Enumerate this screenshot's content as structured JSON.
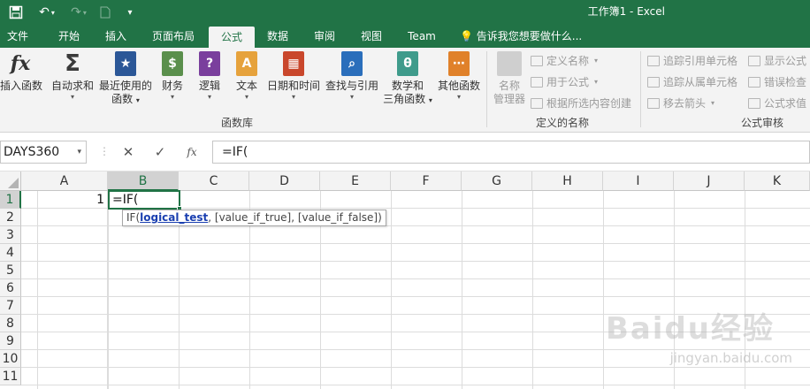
{
  "window": {
    "title": "工作簿1 - Excel"
  },
  "quick_access": {
    "save_icon": "save-icon",
    "undo_icon": "undo-icon",
    "redo_icon": "redo-icon",
    "new_icon": "new-file-icon",
    "customize_icon": "customize-icon"
  },
  "tabs": [
    {
      "label": "文件"
    },
    {
      "label": "开始"
    },
    {
      "label": "插入"
    },
    {
      "label": "页面布局"
    },
    {
      "label": "公式"
    },
    {
      "label": "数据"
    },
    {
      "label": "审阅"
    },
    {
      "label": "视图"
    },
    {
      "label": "Team"
    }
  ],
  "tell_me": "告诉我您想要做什么...",
  "ribbon": {
    "function_library": {
      "label": "函数库",
      "buttons": [
        {
          "label": "插入函数",
          "glyph": "fx",
          "color": "#3a3a3a"
        },
        {
          "label": "自动求和",
          "glyph": "Σ",
          "color": "#4a4a4a"
        },
        {
          "label": "最近使用的",
          "label2": "函数",
          "glyph": "★",
          "color": "#2b5797"
        },
        {
          "label": "财务",
          "glyph": "$",
          "color": "#5a8f4c"
        },
        {
          "label": "逻辑",
          "glyph": "?",
          "color": "#7a3f9d"
        },
        {
          "label": "文本",
          "glyph": "A",
          "color": "#e6a23c"
        },
        {
          "label": "日期和时间",
          "glyph": "▦",
          "color": "#c9472c"
        },
        {
          "label": "查找与引用",
          "glyph": "⌕",
          "color": "#2a6ebb"
        },
        {
          "label": "数学和",
          "label2": "三角函数",
          "glyph": "θ",
          "color": "#3f9b8b"
        },
        {
          "label": "其他函数",
          "glyph": "⋯",
          "color": "#e0812a"
        }
      ]
    },
    "defined_names": {
      "label": "定义的名称",
      "manager_label": "名称",
      "manager_label2": "管理器",
      "items": [
        "定义名称",
        "用于公式",
        "根据所选内容创建"
      ]
    },
    "formula_auditing": {
      "label": "公式审核",
      "items": [
        "追踪引用单元格",
        "追踪从属单元格",
        "移去箭头",
        "显示公式",
        "错误检查",
        "公式求值"
      ]
    }
  },
  "formula_bar": {
    "name_box": "DAYS360",
    "cancel": "✕",
    "enter": "✓",
    "fx": "fx",
    "formula": "=IF("
  },
  "grid": {
    "columns": [
      "A",
      "B",
      "C",
      "D",
      "E",
      "F",
      "G",
      "H",
      "I",
      "J",
      "K"
    ],
    "rows": [
      "1",
      "2",
      "3",
      "4",
      "5",
      "6",
      "7",
      "8",
      "9",
      "10",
      "11"
    ],
    "selected_column": "B",
    "selected_row": "1",
    "cell_a1": "1",
    "cell_b1": "=IF(",
    "tooltip": {
      "prefix": "IF(",
      "active_arg": "logical_test",
      "rest": ", [value_if_true], [value_if_false])"
    }
  },
  "watermark": {
    "text": "Baidu经验",
    "url": "jingyan.baidu.com"
  },
  "colors": {
    "accent": "#217346",
    "link": "#1a3fb0"
  }
}
